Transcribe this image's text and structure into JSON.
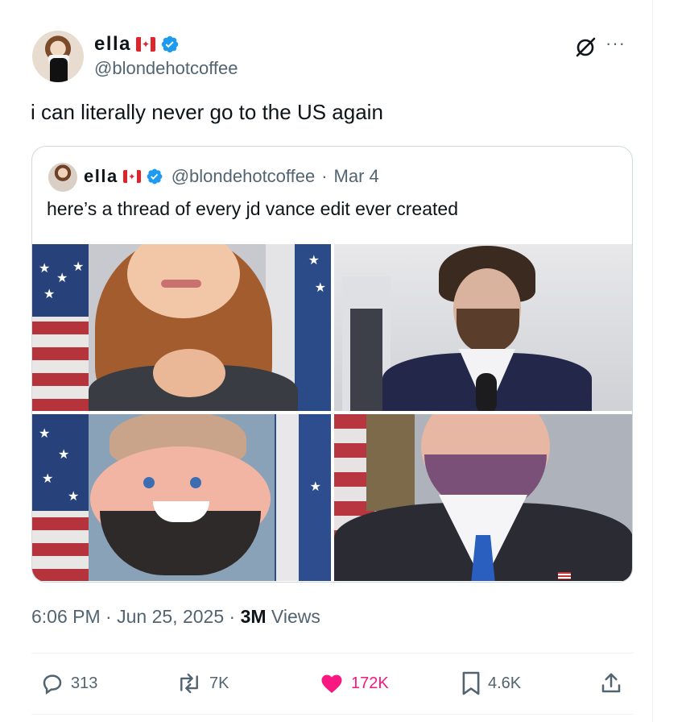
{
  "author": {
    "display_name": "ella",
    "flag_icon": "canada-flag-icon",
    "verified_icon": "verified-badge-icon",
    "handle": "@blondehotcoffee"
  },
  "tweet": {
    "text": "i can literally never go to the US again"
  },
  "quoted_tweet": {
    "display_name": "ella",
    "handle": "@blondehotcoffee",
    "separator": "·",
    "date": "Mar 4",
    "text": "here’s a thread of every jd vance edit ever created"
  },
  "meta": {
    "time": "6:06 PM",
    "sep1": "·",
    "date": "Jun 25, 2025",
    "sep2": "·",
    "views_count": "3M",
    "views_label": "Views"
  },
  "actions": {
    "replies": "313",
    "reposts": "7K",
    "likes": "172K",
    "bookmarks": "4.6K"
  },
  "colors": {
    "verified": "#1d9bf0",
    "like": "#f91880",
    "muted": "#536471",
    "text": "#0f1419"
  }
}
